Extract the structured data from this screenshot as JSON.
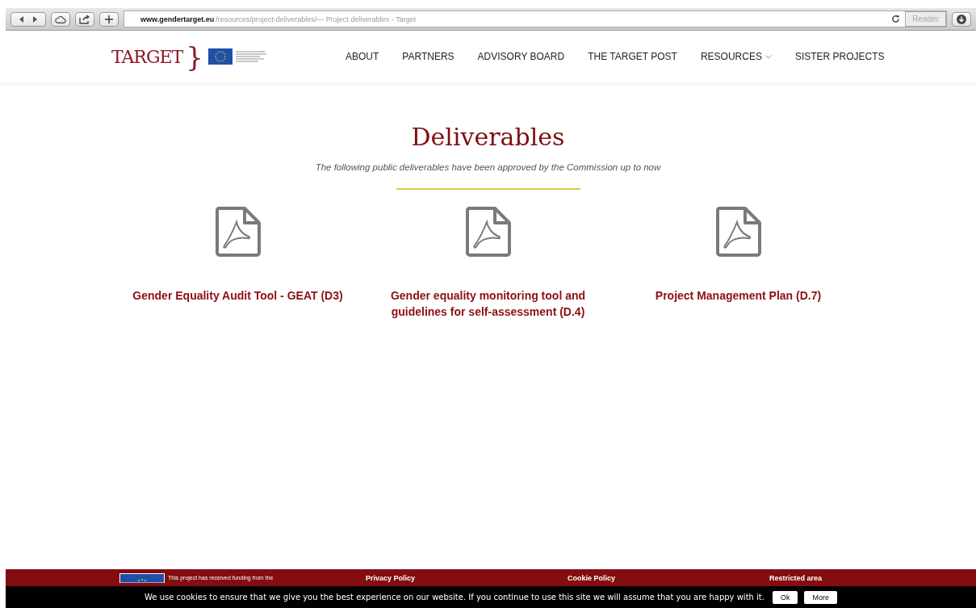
{
  "browser": {
    "url_host": "www.gendertarget.eu",
    "url_path": "/resources/project-deliverables/",
    "page_title": " — Project deliverables - Target",
    "reader": "Reader"
  },
  "site": {
    "logo": "TARGET",
    "brace": "}"
  },
  "nav": [
    {
      "label": "ABOUT",
      "dropdown": false
    },
    {
      "label": "PARTNERS",
      "dropdown": false
    },
    {
      "label": "ADVISORY BOARD",
      "dropdown": false
    },
    {
      "label": "THE TARGET POST",
      "dropdown": false
    },
    {
      "label": "RESOURCES",
      "dropdown": true
    },
    {
      "label": "SISTER PROJECTS",
      "dropdown": false
    }
  ],
  "heading": "Deliverables",
  "subtitle": "The following public deliverables have been approved by the Commission up to now",
  "deliverables": [
    {
      "title": "Gender Equality Audit Tool - GEAT (D3)"
    },
    {
      "title": "Gender equality monitoring tool and guidelines for self-assessment (D.4)"
    },
    {
      "title": "Project Management Plan (D.7)"
    }
  ],
  "footer": {
    "funding": "This project has received funding from the",
    "links": [
      "Privacy Policy",
      "Cookie Policy",
      "Restricted area"
    ]
  },
  "cookie_bar": {
    "message": "We use cookies to ensure that we give you the best experience on our website. If you continue to use this site we will assume that you are happy with it.",
    "buttons": [
      "Ok",
      "More"
    ]
  }
}
